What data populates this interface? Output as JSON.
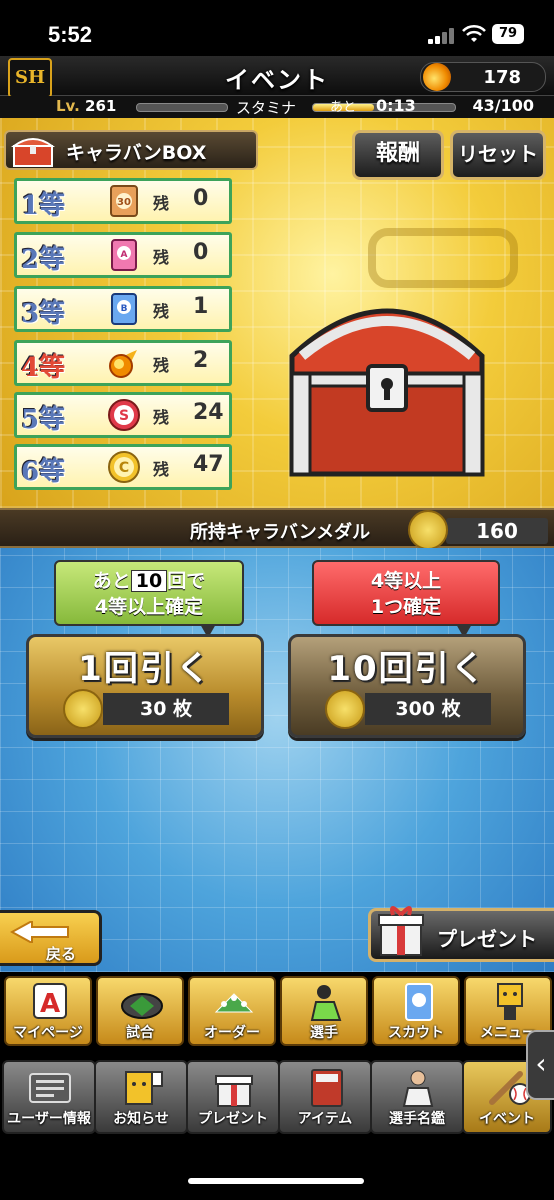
{
  "status": {
    "time": "5:52",
    "battery": "79"
  },
  "header": {
    "title": "イベント",
    "fireball_count": "178"
  },
  "levelbar": {
    "lv_prefix": "Lv.",
    "level": "261",
    "stamina_label": "スタミナ",
    "ato_label": "あと",
    "timer": "0:13",
    "stamina": "43/100",
    "stamina_fill": 0.43
  },
  "box": {
    "title": "キャラバンBOX",
    "reward_button": "報酬",
    "reset_button": "リセット",
    "zan_label": "残",
    "prizes": [
      {
        "rank": "1等",
        "icon": "ticket-30-icon",
        "count": "0",
        "color": "#5a78b8"
      },
      {
        "rank": "2等",
        "icon": "pink-card-icon",
        "count": "0",
        "color": "#5a78b8"
      },
      {
        "rank": "3等",
        "icon": "blue-card-icon",
        "count": "1",
        "color": "#5a78b8"
      },
      {
        "rank": "4等",
        "icon": "fireball-icon",
        "count": "2",
        "color": "#e24a37"
      },
      {
        "rank": "5等",
        "icon": "red-s-coin-icon",
        "count": "24",
        "color": "#5a78b8"
      },
      {
        "rank": "6等",
        "icon": "gold-c-coin-icon",
        "count": "47",
        "color": "#5a78b8"
      }
    ]
  },
  "medal": {
    "label": "所持キャラバンメダル",
    "value": "160"
  },
  "draw": {
    "single": {
      "bubble_pre": "あと",
      "bubble_num": "10",
      "bubble_post": "回で",
      "bubble_line2": "4等以上確定",
      "title": "1回引く",
      "cost": "30 枚"
    },
    "ten": {
      "bubble_line1": "4等以上",
      "bubble_line2": "1つ確定",
      "title": "10回引く",
      "cost": "300 枚"
    }
  },
  "buttons": {
    "back": "戻る",
    "present": "プレゼント"
  },
  "nav_top": [
    {
      "label": "マイページ",
      "icon": "mypage-a-icon"
    },
    {
      "label": "試合",
      "icon": "stadium-icon"
    },
    {
      "label": "オーダー",
      "icon": "lineup-icon"
    },
    {
      "label": "選手",
      "icon": "player-icon"
    },
    {
      "label": "スカウト",
      "icon": "scout-card-icon"
    },
    {
      "label": "メニュー",
      "icon": "menu-mascot-icon"
    }
  ],
  "nav_bottom": [
    {
      "label": "ユーザー情報",
      "icon": "user-info-icon"
    },
    {
      "label": "お知らせ",
      "icon": "news-icon"
    },
    {
      "label": "プレゼント",
      "icon": "gift-icon"
    },
    {
      "label": "アイテム",
      "icon": "item-book-icon"
    },
    {
      "label": "選手名鑑",
      "icon": "player-directory-icon"
    },
    {
      "label": "イベント",
      "icon": "event-baseball-icon"
    }
  ]
}
